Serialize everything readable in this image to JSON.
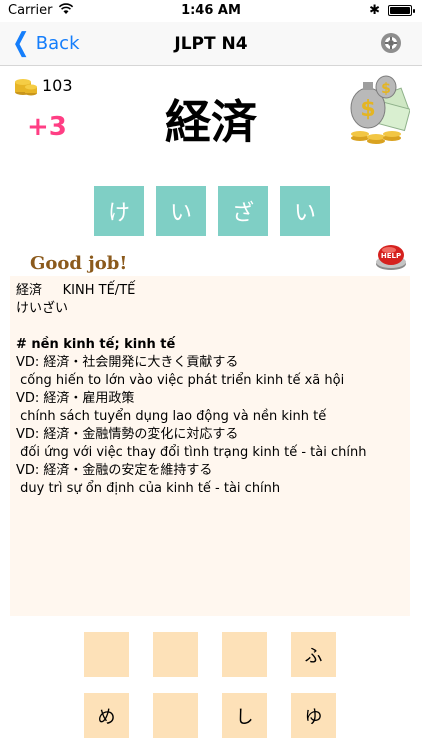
{
  "status_bar": {
    "carrier": "Carrier",
    "time": "1:46 AM",
    "wifi_icon": "wifi-icon",
    "bluetooth": "✱",
    "battery_icon": "battery-icon"
  },
  "nav": {
    "back_label": "Back",
    "back_icon": "chevron-left-icon",
    "title": "JLPT N4",
    "settings_icon": "settings-icon"
  },
  "score": {
    "coins": "103",
    "bonus": "+3"
  },
  "word": {
    "kanji": "経済"
  },
  "answer_kana": [
    "け",
    "い",
    "ざ",
    "い"
  ],
  "feedback": "Good job!",
  "help_label": "HELP",
  "explanation": {
    "headword": "経済     KINH TẾ/TẾ",
    "reading": "けいざい",
    "meaning": "# nền kinh tế; kinh tế",
    "examples": [
      "VD: 経済・社会開発に大きく貢献する",
      " cống hiến to lớn vào việc phát triển kinh tế xã hội",
      "VD: 経済・雇用政策",
      " chính sách tuyển dụng lao động và nền kinh tế",
      "VD: 経済・金融情勢の変化に対応する",
      " đối ứng với việc thay đổi tình trạng kinh tế - tài chính",
      "VD: 経済・金融の安定を維持する",
      " duy trì sự ổn định của kinh tế - tài chính"
    ]
  },
  "choices": [
    "",
    "",
    "",
    "ふ",
    "め",
    "",
    "し",
    "ゆ"
  ],
  "colors": {
    "accent": "#157efb",
    "tile": "#7fcfc5",
    "choice": "#fde1b8",
    "panel": "#fff7ef",
    "bonus": "#ff3e84",
    "feedback": "#8b5a1c"
  }
}
